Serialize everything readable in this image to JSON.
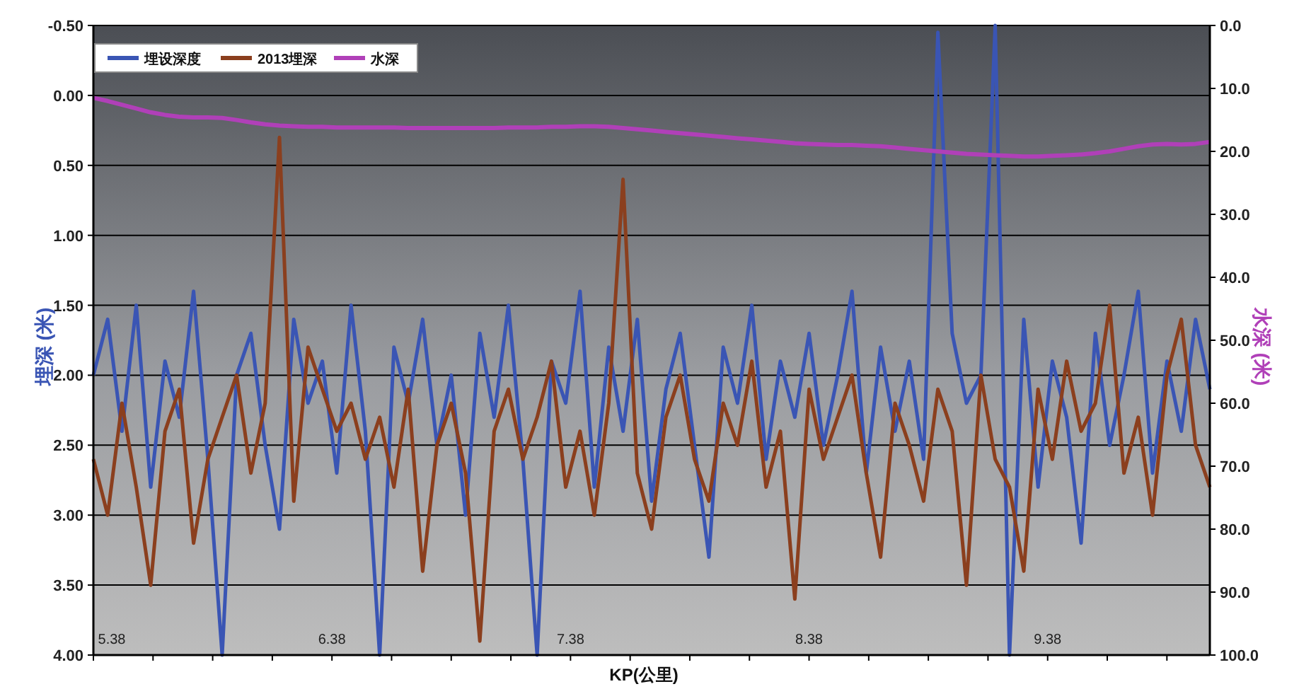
{
  "chart_data": {
    "type": "line",
    "xlabel": "KP(公里)",
    "ylabel": "埋深 (米)",
    "y2label": "水深 (米)",
    "xlim": [
      5.38,
      10.06
    ],
    "ylim": [
      4.0,
      -0.5
    ],
    "y2lim": [
      100,
      0
    ],
    "grid": "y",
    "legend": "top-left",
    "xticks": [
      {
        "value": 5.38,
        "label": "5.38"
      },
      {
        "value": 6.38,
        "label": "6.38"
      },
      {
        "value": 7.38,
        "label": "7.38"
      },
      {
        "value": 8.38,
        "label": "8.38"
      },
      {
        "value": 9.38,
        "label": "9.38"
      }
    ],
    "yticks": [
      {
        "value": -0.5,
        "label": "-0.50"
      },
      {
        "value": 0,
        "label": "0.00"
      },
      {
        "value": 0.5,
        "label": "0.50"
      },
      {
        "value": 1,
        "label": "1.00"
      },
      {
        "value": 1.5,
        "label": "1.50"
      },
      {
        "value": 2,
        "label": "2.00"
      },
      {
        "value": 2.5,
        "label": "2.50"
      },
      {
        "value": 3,
        "label": "3.00"
      },
      {
        "value": 3.5,
        "label": "3.50"
      },
      {
        "value": 4,
        "label": "4.00"
      }
    ],
    "y2ticks": [
      {
        "value": 0,
        "label": "0.0"
      },
      {
        "value": 10,
        "label": "10.0"
      },
      {
        "value": 20,
        "label": "20.0"
      },
      {
        "value": 30,
        "label": "30.0"
      },
      {
        "value": 40,
        "label": "40.0"
      },
      {
        "value": 50,
        "label": "50.0"
      },
      {
        "value": 60,
        "label": "60.0"
      },
      {
        "value": 70,
        "label": "70.0"
      },
      {
        "value": 80,
        "label": "80.0"
      },
      {
        "value": 90,
        "label": "90.0"
      },
      {
        "value": 100,
        "label": "100.0"
      }
    ],
    "x": [
      5.38,
      5.44,
      5.5,
      5.56,
      5.62,
      5.68,
      5.74,
      5.8,
      5.86,
      5.92,
      5.98,
      6.04,
      6.1,
      6.16,
      6.22,
      6.28,
      6.34,
      6.4,
      6.46,
      6.52,
      6.58,
      6.64,
      6.7,
      6.76,
      6.82,
      6.88,
      6.94,
      7.0,
      7.06,
      7.12,
      7.18,
      7.24,
      7.3,
      7.36,
      7.42,
      7.48,
      7.54,
      7.6,
      7.66,
      7.72,
      7.78,
      7.84,
      7.9,
      7.96,
      8.02,
      8.08,
      8.14,
      8.2,
      8.26,
      8.32,
      8.38,
      8.44,
      8.5,
      8.56,
      8.62,
      8.68,
      8.74,
      8.8,
      8.86,
      8.92,
      8.98,
      9.04,
      9.1,
      9.16,
      9.22,
      9.28,
      9.34,
      9.4,
      9.46,
      9.52,
      9.58,
      9.64,
      9.7,
      9.76,
      9.82,
      9.88,
      9.94,
      10.0,
      10.06
    ],
    "series": [
      {
        "name": "埋设深度",
        "color": "#3a55b4",
        "values": [
          2.0,
          1.6,
          2.4,
          1.5,
          2.8,
          1.9,
          2.3,
          1.4,
          2.6,
          4.0,
          2.0,
          1.7,
          2.5,
          3.1,
          1.6,
          2.2,
          1.9,
          2.7,
          1.5,
          2.4,
          4.0,
          1.8,
          2.2,
          1.6,
          2.5,
          2.0,
          3.0,
          1.7,
          2.3,
          1.5,
          2.6,
          4.0,
          1.9,
          2.2,
          1.4,
          2.8,
          1.8,
          2.4,
          1.6,
          2.9,
          2.1,
          1.7,
          2.5,
          3.3,
          1.8,
          2.2,
          1.5,
          2.6,
          1.9,
          2.3,
          1.7,
          2.5,
          2.0,
          1.4,
          2.7,
          1.8,
          2.4,
          1.9,
          2.6,
          -0.45,
          1.7,
          2.2,
          2.0,
          -0.5,
          4.0,
          1.6,
          2.8,
          1.9,
          2.3,
          3.2,
          1.7,
          2.5,
          2.0,
          1.4,
          2.7,
          1.9,
          2.4,
          1.6,
          2.1
        ]
      },
      {
        "name": "2013埋深",
        "color": "#8b3f1e",
        "values": [
          2.6,
          3.0,
          2.2,
          2.8,
          3.5,
          2.4,
          2.1,
          3.2,
          2.6,
          2.3,
          2.0,
          2.7,
          2.2,
          0.3,
          2.9,
          1.8,
          2.1,
          2.4,
          2.2,
          2.6,
          2.3,
          2.8,
          2.1,
          3.4,
          2.5,
          2.2,
          2.7,
          3.9,
          2.4,
          2.1,
          2.6,
          2.3,
          1.9,
          2.8,
          2.4,
          3.0,
          2.2,
          0.6,
          2.7,
          3.1,
          2.3,
          2.0,
          2.6,
          2.9,
          2.2,
          2.5,
          1.9,
          2.8,
          2.4,
          3.6,
          2.1,
          2.6,
          2.3,
          2.0,
          2.7,
          3.3,
          2.2,
          2.5,
          2.9,
          2.1,
          2.4,
          3.5,
          2.0,
          2.6,
          2.8,
          3.4,
          2.1,
          2.6,
          1.9,
          2.4,
          2.2,
          1.5,
          2.7,
          2.3,
          3.0,
          2.0,
          1.6,
          2.5,
          2.8
        ]
      },
      {
        "name": "水深",
        "color": "#b040b8",
        "axis": "y2",
        "values": [
          11.5,
          12.0,
          12.6,
          13.2,
          13.8,
          14.2,
          14.5,
          14.6,
          14.6,
          14.7,
          15.0,
          15.4,
          15.7,
          15.9,
          16.0,
          16.1,
          16.1,
          16.2,
          16.2,
          16.2,
          16.2,
          16.2,
          16.3,
          16.3,
          16.3,
          16.3,
          16.3,
          16.3,
          16.3,
          16.2,
          16.2,
          16.2,
          16.1,
          16.1,
          16.0,
          16.0,
          16.1,
          16.3,
          16.5,
          16.7,
          16.9,
          17.1,
          17.3,
          17.5,
          17.7,
          17.9,
          18.1,
          18.3,
          18.5,
          18.7,
          18.8,
          18.9,
          19.0,
          19.0,
          19.1,
          19.2,
          19.4,
          19.6,
          19.8,
          20.0,
          20.2,
          20.4,
          20.5,
          20.6,
          20.7,
          20.8,
          20.8,
          20.7,
          20.6,
          20.5,
          20.3,
          20.0,
          19.6,
          19.2,
          18.9,
          18.8,
          18.9,
          18.8,
          18.5
        ]
      }
    ]
  }
}
